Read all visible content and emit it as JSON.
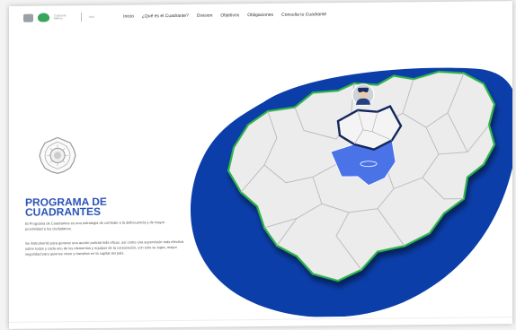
{
  "nav": {
    "items": [
      {
        "label": "Inicio"
      },
      {
        "label": "¿Qué es el Cuadrante?"
      },
      {
        "label": "Division"
      },
      {
        "label": "Objetivos"
      },
      {
        "label": "Obligaciones"
      },
      {
        "label": "Consulta tu Cuadrante"
      }
    ]
  },
  "brand": {
    "org_text": "Ciudad de México",
    "gov_text": "SSC"
  },
  "hero": {
    "title": "PROGRAMA DE CUADRANTES",
    "intro": "El Programa de Cuadrantes es una estrategia de combate a la delincuencia y de mayor proximidad a los ciudadanos.",
    "body": "Se instrumentó para generar una acción policial más eficaz, así como una supervisión más efectiva sobre todos y cada uno de los elementos y equipos de la corporación, con esto se logra, mayor seguridad para quienes viven y transitan en la capital del país."
  },
  "colors": {
    "accent": "#2a54b8",
    "map_blob": "#0b3ea8",
    "map_land": "#eeeeee",
    "map_border": "#2db34a",
    "highlight": "#4a73e8"
  },
  "icons": {
    "badge": "police-badge-icon",
    "avatar": "police-officer-icon"
  }
}
